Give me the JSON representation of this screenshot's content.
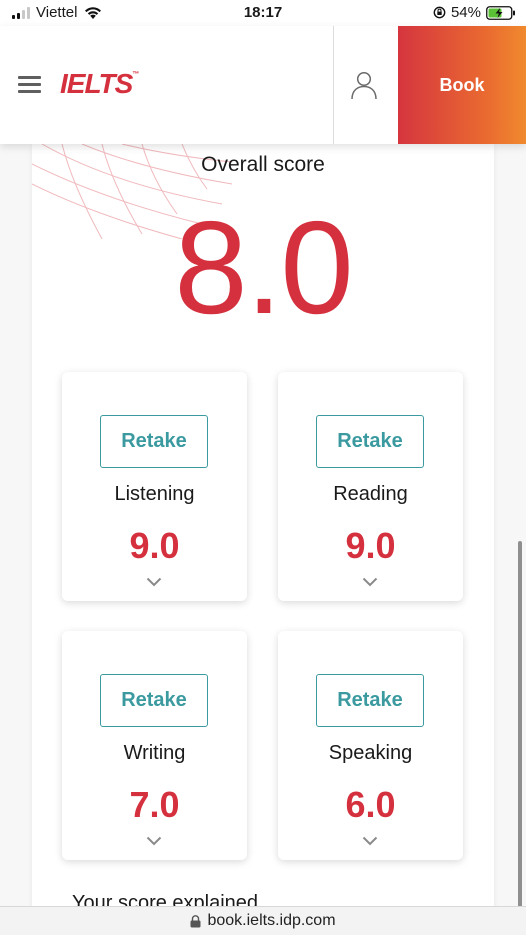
{
  "status": {
    "carrier": "Viettel",
    "time": "18:17",
    "battery": "54%"
  },
  "header": {
    "logo_text": "IELTS",
    "logo_mark": "™",
    "book_label": "Book"
  },
  "overall": {
    "label": "Overall score",
    "score": "8.0"
  },
  "skills": [
    {
      "name": "Listening",
      "score": "9.0",
      "action": "Retake"
    },
    {
      "name": "Reading",
      "score": "9.0",
      "action": "Retake"
    },
    {
      "name": "Writing",
      "score": "7.0",
      "action": "Retake"
    },
    {
      "name": "Speaking",
      "score": "6.0",
      "action": "Retake"
    }
  ],
  "footer_text": "Your score explained",
  "url": "book.ielts.idp.com",
  "colors": {
    "brand_red": "#d5303e",
    "teal": "#3a9aa0",
    "book_gradient_start": "#d5353f",
    "book_gradient_end": "#f08a2e"
  },
  "icons": [
    "signal-icon",
    "wifi-icon",
    "rotation-lock-icon",
    "battery-charging-icon",
    "menu-icon",
    "account-icon",
    "chevron-down-icon",
    "padlock-icon"
  ]
}
